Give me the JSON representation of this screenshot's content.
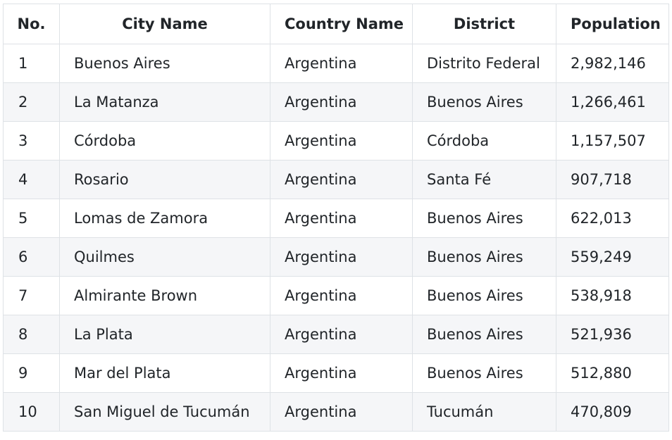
{
  "table": {
    "headers": {
      "no": "No.",
      "city": "City Name",
      "country": "Country Name",
      "district": "District",
      "population": "Population"
    },
    "rows": [
      {
        "no": "1",
        "city": "Buenos Aires",
        "country": "Argentina",
        "district": "Distrito Federal",
        "population": "2,982,146"
      },
      {
        "no": "2",
        "city": "La Matanza",
        "country": "Argentina",
        "district": "Buenos Aires",
        "population": "1,266,461"
      },
      {
        "no": "3",
        "city": "Córdoba",
        "country": "Argentina",
        "district": "Córdoba",
        "population": "1,157,507"
      },
      {
        "no": "4",
        "city": "Rosario",
        "country": "Argentina",
        "district": "Santa Fé",
        "population": "907,718"
      },
      {
        "no": "5",
        "city": "Lomas de Zamora",
        "country": "Argentina",
        "district": "Buenos Aires",
        "population": "622,013"
      },
      {
        "no": "6",
        "city": "Quilmes",
        "country": "Argentina",
        "district": "Buenos Aires",
        "population": "559,249"
      },
      {
        "no": "7",
        "city": "Almirante Brown",
        "country": "Argentina",
        "district": "Buenos Aires",
        "population": "538,918"
      },
      {
        "no": "8",
        "city": "La Plata",
        "country": "Argentina",
        "district": "Buenos Aires",
        "population": "521,936"
      },
      {
        "no": "9",
        "city": "Mar del Plata",
        "country": "Argentina",
        "district": "Buenos Aires",
        "population": "512,880"
      },
      {
        "no": "10",
        "city": "San Miguel de Tucumán",
        "country": "Argentina",
        "district": "Tucumán",
        "population": "470,809"
      }
    ]
  }
}
